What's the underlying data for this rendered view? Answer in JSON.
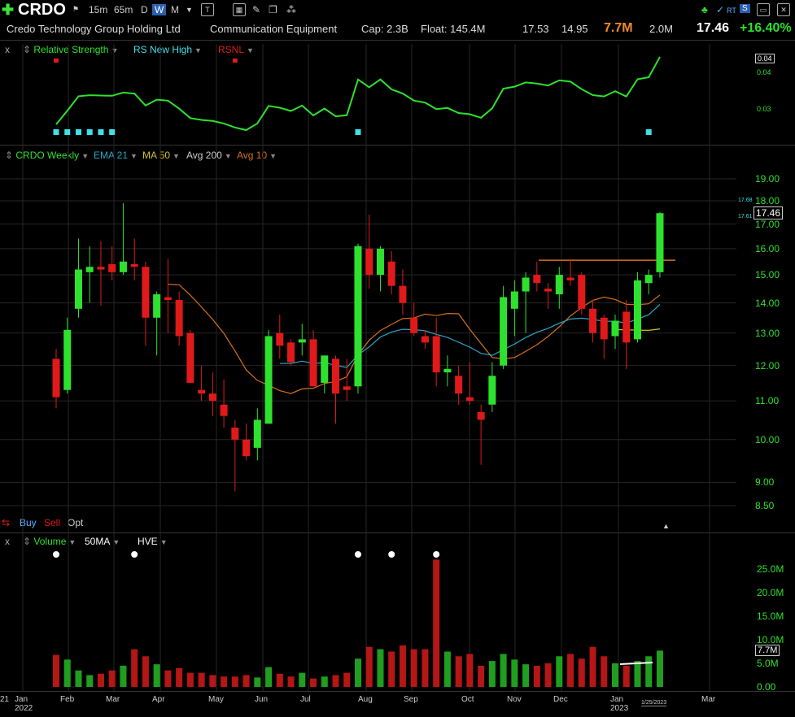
{
  "toolbar": {
    "symbol": "CRDO",
    "timeframes": [
      "15m",
      "65m",
      "D",
      "W",
      "M"
    ],
    "active_timeframe": "W",
    "icons": [
      "add-icon",
      "flag-icon",
      "dropdown-icon",
      "text-icon",
      "grid-icon",
      "pencil-icon",
      "stack-icon",
      "share-icon",
      "tree-icon",
      "rt-icon",
      "s-icon",
      "window-icon",
      "close-icon"
    ],
    "rt_label": "RT",
    "s_label": "S"
  },
  "info": {
    "company": "Credo Technology Group Holding Ltd",
    "industry": "Communication Equipment",
    "cap": "Cap: 2.3B",
    "float": "Float: 145.4M",
    "high": "17.53",
    "low": "14.95",
    "volume": "7.7M",
    "avg_volume": "2.0M",
    "price": "17.46",
    "change": "+16.40%"
  },
  "rs_panel": {
    "close": "x",
    "items": [
      "Relative Strength",
      "RS New High",
      "RSNL"
    ],
    "scale": [
      "0.04",
      "0.03"
    ],
    "last_tag": "0.04"
  },
  "price_panel": {
    "items": [
      "CRDO Weekly",
      "EMA 21",
      "MA 50",
      "Avg 200",
      "Avg 10"
    ],
    "scale": [
      "19.00",
      "18.00",
      "17.00",
      "16.00",
      "15.00",
      "14.00",
      "13.00",
      "12.00",
      "11.00",
      "10.00",
      "9.00",
      "8.50"
    ],
    "price_tag": "17.46",
    "hi_tag": "17.68",
    "lo_tag": "17.61",
    "buy": "Buy",
    "sell": "Sell",
    "opt": "Opt"
  },
  "volume_panel": {
    "close": "x",
    "items": [
      "Volume",
      "50MA",
      "HVE"
    ],
    "scale": [
      "25.0M",
      "20.0M",
      "15.0M",
      "10.0M",
      "5.0M",
      "0.00"
    ],
    "last_tag": "7.7M"
  },
  "x_axis": {
    "months": [
      "Jan 2022",
      "Feb",
      "Mar",
      "Apr",
      "May",
      "Jun",
      "Jul",
      "Aug",
      "Sep",
      "Oct",
      "Nov",
      "Dec",
      "Jan 2023",
      "Mar"
    ],
    "left_cut": "21",
    "date_tag": "1/25/2023"
  },
  "colors": {
    "up": "#2ee12e",
    "down": "#e01a1a",
    "ema21": "#2aa7c7",
    "ma50": "#d4701f",
    "avg10": "#d4c21f",
    "hve_dot": "#ffffff",
    "rs_line": "#2ee12e",
    "rs_marker": "#3fe0e8",
    "rs_red_marker": "#e01a1a"
  },
  "chart_data": {
    "type": "candlestick",
    "series": [
      {
        "o": 12.2,
        "h": 12.5,
        "l": 10.8,
        "c": 11.1
      },
      {
        "o": 11.3,
        "h": 13.5,
        "l": 11.2,
        "c": 13.1
      },
      {
        "o": 13.8,
        "h": 16.4,
        "l": 13.5,
        "c": 15.2
      },
      {
        "o": 15.1,
        "h": 16.1,
        "l": 14.0,
        "c": 15.3
      },
      {
        "o": 15.3,
        "h": 16.3,
        "l": 13.9,
        "c": 15.2
      },
      {
        "o": 15.4,
        "h": 16.1,
        "l": 14.8,
        "c": 15.1
      },
      {
        "o": 15.1,
        "h": 17.9,
        "l": 15.0,
        "c": 15.5
      },
      {
        "o": 15.4,
        "h": 16.4,
        "l": 14.8,
        "c": 15.3
      },
      {
        "o": 15.3,
        "h": 15.5,
        "l": 12.6,
        "c": 13.5
      },
      {
        "o": 13.5,
        "h": 14.4,
        "l": 12.3,
        "c": 14.3
      },
      {
        "o": 14.2,
        "h": 15.6,
        "l": 13.0,
        "c": 14.1
      },
      {
        "o": 14.1,
        "h": 14.4,
        "l": 12.6,
        "c": 12.9
      },
      {
        "o": 13.0,
        "h": 13.1,
        "l": 11.5,
        "c": 11.5
      },
      {
        "o": 11.3,
        "h": 12.0,
        "l": 11.0,
        "c": 11.2
      },
      {
        "o": 11.2,
        "h": 11.8,
        "l": 10.6,
        "c": 11.0
      },
      {
        "o": 10.9,
        "h": 11.6,
        "l": 10.3,
        "c": 10.6
      },
      {
        "o": 10.3,
        "h": 10.5,
        "l": 8.8,
        "c": 10.0
      },
      {
        "o": 10.0,
        "h": 10.4,
        "l": 9.5,
        "c": 9.6
      },
      {
        "o": 9.8,
        "h": 10.8,
        "l": 9.5,
        "c": 10.5
      },
      {
        "o": 10.4,
        "h": 13.1,
        "l": 10.4,
        "c": 12.9
      },
      {
        "o": 13.0,
        "h": 13.6,
        "l": 12.2,
        "c": 12.6
      },
      {
        "o": 12.7,
        "h": 12.8,
        "l": 12.0,
        "c": 12.1
      },
      {
        "o": 12.7,
        "h": 13.3,
        "l": 12.3,
        "c": 12.8
      },
      {
        "o": 12.8,
        "h": 13.1,
        "l": 11.4,
        "c": 11.4
      },
      {
        "o": 11.5,
        "h": 12.3,
        "l": 11.2,
        "c": 12.3
      },
      {
        "o": 12.2,
        "h": 12.3,
        "l": 10.4,
        "c": 11.2
      },
      {
        "o": 11.4,
        "h": 12.2,
        "l": 11.0,
        "c": 11.3
      },
      {
        "o": 11.4,
        "h": 16.2,
        "l": 11.2,
        "c": 16.1
      },
      {
        "o": 16.0,
        "h": 17.4,
        "l": 14.5,
        "c": 15.0
      },
      {
        "o": 15.0,
        "h": 16.1,
        "l": 14.4,
        "c": 16.0
      },
      {
        "o": 15.5,
        "h": 15.9,
        "l": 14.3,
        "c": 14.6
      },
      {
        "o": 14.6,
        "h": 15.2,
        "l": 13.6,
        "c": 14.0
      },
      {
        "o": 13.5,
        "h": 14.0,
        "l": 12.9,
        "c": 13.0
      },
      {
        "o": 12.9,
        "h": 13.1,
        "l": 12.5,
        "c": 12.7
      },
      {
        "o": 12.9,
        "h": 13.5,
        "l": 11.4,
        "c": 11.8
      },
      {
        "o": 11.8,
        "h": 12.3,
        "l": 11.4,
        "c": 11.9
      },
      {
        "o": 11.7,
        "h": 12.0,
        "l": 10.9,
        "c": 11.2
      },
      {
        "o": 11.1,
        "h": 12.1,
        "l": 10.9,
        "c": 11.0
      },
      {
        "o": 10.7,
        "h": 10.9,
        "l": 9.4,
        "c": 10.5
      },
      {
        "o": 10.9,
        "h": 12.1,
        "l": 10.7,
        "c": 11.7
      },
      {
        "o": 12.0,
        "h": 14.6,
        "l": 11.9,
        "c": 14.2
      },
      {
        "o": 13.8,
        "h": 14.8,
        "l": 12.9,
        "c": 14.4
      },
      {
        "o": 14.4,
        "h": 15.1,
        "l": 13.0,
        "c": 14.9
      },
      {
        "o": 15.0,
        "h": 15.5,
        "l": 14.4,
        "c": 14.7
      },
      {
        "o": 14.5,
        "h": 14.7,
        "l": 13.8,
        "c": 14.4
      },
      {
        "o": 14.3,
        "h": 15.3,
        "l": 13.8,
        "c": 15.0
      },
      {
        "o": 14.9,
        "h": 15.6,
        "l": 14.6,
        "c": 14.8
      },
      {
        "o": 15.0,
        "h": 15.1,
        "l": 13.6,
        "c": 13.8
      },
      {
        "o": 13.8,
        "h": 14.1,
        "l": 12.7,
        "c": 13.0
      },
      {
        "o": 13.5,
        "h": 13.6,
        "l": 12.2,
        "c": 12.8
      },
      {
        "o": 12.9,
        "h": 13.6,
        "l": 12.5,
        "c": 13.4
      },
      {
        "o": 13.7,
        "h": 14.1,
        "l": 11.9,
        "c": 12.7
      },
      {
        "o": 12.8,
        "h": 15.1,
        "l": 12.7,
        "c": 14.8
      },
      {
        "o": 14.7,
        "h": 15.2,
        "l": 14.3,
        "c": 15.0
      },
      {
        "o": 15.1,
        "h": 17.5,
        "l": 14.9,
        "c": 17.46
      }
    ],
    "volume_millions": [
      6.8,
      5.8,
      3.5,
      2.5,
      2.8,
      3.5,
      4.5,
      8.0,
      6.5,
      4.8,
      3.5,
      4.0,
      3.0,
      3.0,
      2.5,
      2.2,
      2.2,
      2.5,
      2.0,
      4.2,
      2.8,
      2.2,
      3.0,
      1.8,
      2.2,
      2.5,
      3.0,
      6.0,
      8.5,
      8.0,
      7.5,
      8.8,
      8.0,
      8.0,
      27.0,
      7.5,
      6.5,
      7.0,
      4.5,
      5.5,
      7.0,
      5.8,
      4.8,
      4.5,
      5.0,
      6.5,
      7.0,
      6.0,
      8.5,
      6.5,
      5.0,
      4.5,
      5.5,
      6.5,
      7.7
    ],
    "xlim_weeks": [
      0,
      54
    ],
    "ylim": [
      8.5,
      19.5
    ],
    "y_scale": "log",
    "resistance_line": 15.55
  }
}
